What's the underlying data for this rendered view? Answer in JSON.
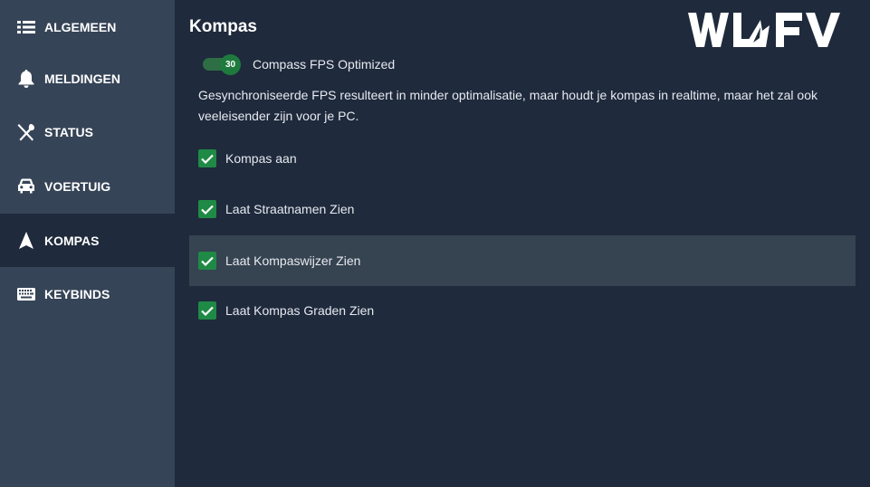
{
  "sidebar": {
    "items": [
      {
        "label": "ALGEMEEN",
        "icon": "list-icon",
        "active": false
      },
      {
        "label": "MELDINGEN",
        "icon": "bell-icon",
        "active": false
      },
      {
        "label": "STATUS",
        "icon": "utensils-icon",
        "active": false
      },
      {
        "label": "VOERTUIG",
        "icon": "car-icon",
        "active": false
      },
      {
        "label": "KOMPAS",
        "icon": "navigation-arrow-icon",
        "active": true
      },
      {
        "label": "KEYBINDS",
        "icon": "keyboard-icon",
        "active": false
      }
    ]
  },
  "logo": {
    "text": "WLFV"
  },
  "main": {
    "title": "Kompas",
    "toggle": {
      "value": "30",
      "label": "Compass FPS Optimized",
      "on": true
    },
    "description": "Gesynchroniseerde FPS resulteert in minder optimalisatie, maar houdt je kompas in realtime, maar het zal ook veeleisender zijn voor je PC.",
    "options": [
      {
        "label": "Kompas aan",
        "checked": true
      },
      {
        "label": "Laat Straatnamen Zien",
        "checked": true
      },
      {
        "label": "Laat Kompaswijzer Zien",
        "checked": true,
        "hovered": true
      },
      {
        "label": "Laat Kompas Graden Zien",
        "checked": true
      }
    ]
  },
  "colors": {
    "background": "#1f2a3c",
    "sidebar": "#364457",
    "accent_green": "#1f8a45",
    "highlight_row": "#364351"
  }
}
